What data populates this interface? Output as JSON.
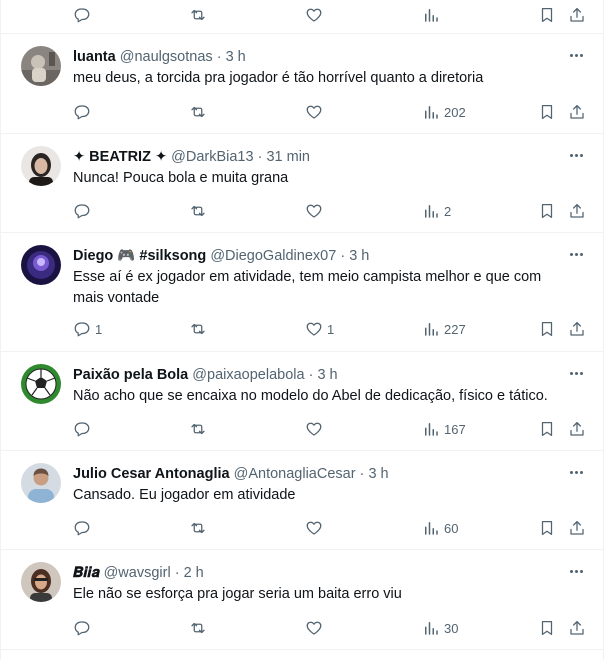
{
  "colors": {
    "text": "#0f1419",
    "secondary": "#536471",
    "divider": "#eff3f4",
    "background": "#ffffff"
  },
  "tweets": [
    {
      "name": "luanta",
      "handle": "@naulgsotnas",
      "dot": "·",
      "time": "3 h",
      "text": "meu deus, a torcida pra jogador é tão horrível quanto a diretoria",
      "replies": "",
      "retweets": "",
      "likes": "",
      "views": "202",
      "avatar_icon": "photo-avatar-icon"
    },
    {
      "name": "✦ BEATRIZ ✦",
      "handle": "@DarkBia13",
      "dot": "·",
      "time": "31 min",
      "text": "Nunca! Pouca bola e muita grana",
      "replies": "",
      "retweets": "",
      "likes": "",
      "views": "2",
      "avatar_icon": "photo-avatar-icon"
    },
    {
      "name": "Diego 🎮 #silksong",
      "handle": "@DiegoGaldinex07",
      "dot": "·",
      "time": "3 h",
      "text": "Esse aí é ex jogador em atividade, tem meio campista melhor e que com mais vontade",
      "replies": "1",
      "retweets": "",
      "likes": "1",
      "views": "227",
      "avatar_icon": "photo-avatar-icon"
    },
    {
      "name": "Paixão pela Bola",
      "handle": "@paixaopelabola",
      "dot": "·",
      "time": "3 h",
      "text": "Não acho que se encaixa no modelo do Abel de dedicação, físico e tático.",
      "replies": "",
      "retweets": "",
      "likes": "",
      "views": "167",
      "avatar_icon": "soccer-ball-avatar-icon"
    },
    {
      "name": "Julio Cesar Antonaglia",
      "handle": "@AntonagliaCesar",
      "dot": "·",
      "time": "3 h",
      "text": "Cansado. Eu jogador em atividade",
      "replies": "",
      "retweets": "",
      "likes": "",
      "views": "60",
      "avatar_icon": "photo-avatar-icon"
    },
    {
      "name": "𝑩𝒊𝒊𝒂",
      "handle": "@wavsgirl",
      "dot": "·",
      "time": "2 h",
      "text": "Ele não se esforça pra jogar seria um baita erro viu",
      "replies": "",
      "retweets": "",
      "likes": "",
      "views": "30",
      "avatar_icon": "photo-avatar-icon"
    }
  ]
}
